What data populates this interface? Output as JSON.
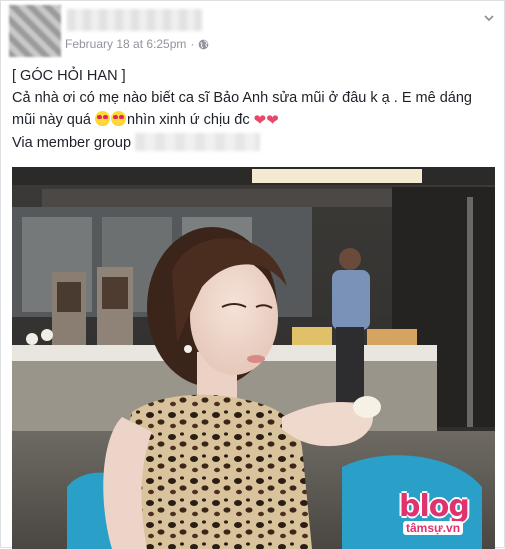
{
  "post": {
    "timestamp": "February 18 at 6:25pm",
    "separator": "·",
    "text": {
      "line1": "[ GÓC HỎI HAN ]",
      "line2": "Cả nhà ơi có mẹ nào biết ca sĩ Bảo Anh sửa mũi ở đâu k ạ . E mê dáng",
      "line3_before": "mũi này quá ",
      "line3_after": "nhìn xinh ứ chịu đc ",
      "via": "Via member group"
    },
    "icons": {
      "privacy": "globe-icon",
      "menu": "chevron-down-icon",
      "emoji": "heart-eyes-emoji",
      "heart": "red-heart-emoji"
    },
    "heart_glyph": "❤",
    "photo": {
      "watermark_main": "blog",
      "watermark_sub": "tâmsự.vn"
    }
  }
}
